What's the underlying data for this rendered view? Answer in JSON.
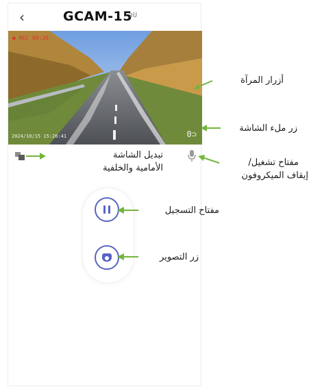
{
  "header": {
    "back_glyph": "‹",
    "title": "GCAM-15",
    "title_extra": "ᴈU"
  },
  "video": {
    "rec_text": "● REC 00:26",
    "timestamp": "2024/10/15 15:26:41",
    "fill_glyph": "0⊃"
  },
  "annotations": {
    "mirror": "أزرار المرآة",
    "fill_screen": "زر ملء الشاشة",
    "switch_line1": "تبديل الشاشة",
    "switch_line2": "الأمامية والخلفية",
    "mic_line1": "مفتاح تشغيل/",
    "mic_line2": "إيقاف الميكروفون",
    "record": "مفتاح التسجيل",
    "photo": "زر التصوير"
  },
  "colors": {
    "accent": "#5664c4",
    "arrow": "#73b53d",
    "rec": "#e0362c"
  },
  "icons": {
    "switch": "screen-switch-icon",
    "mic": "microphone-icon",
    "pause": "pause-icon",
    "camera": "camera-icon"
  }
}
